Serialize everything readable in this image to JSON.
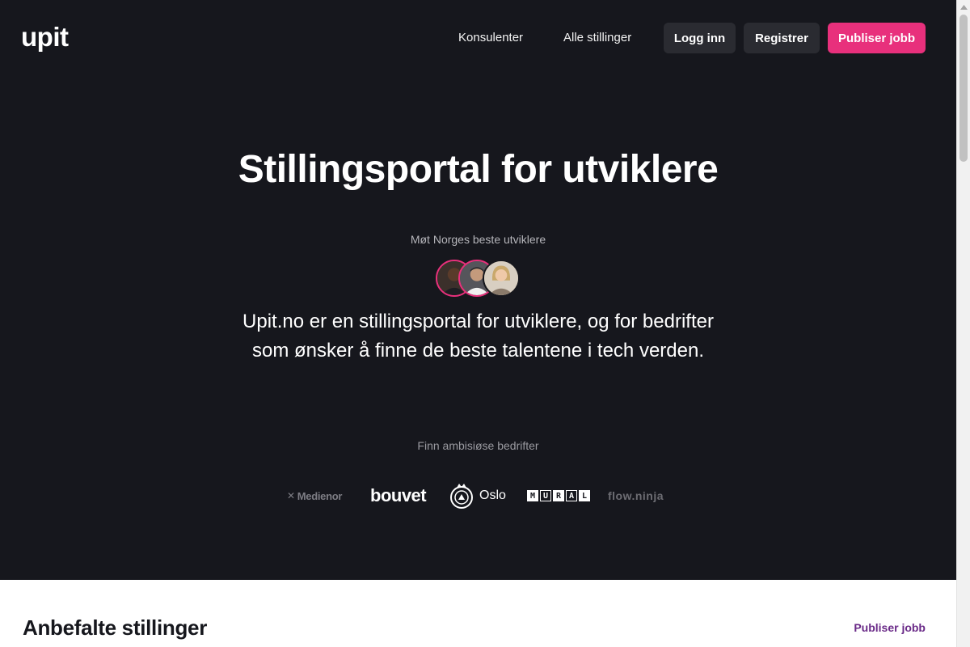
{
  "header": {
    "logo": "upit",
    "nav": [
      {
        "label": "Konsulenter"
      },
      {
        "label": "Alle stillinger"
      }
    ],
    "login_label": "Logg inn",
    "register_label": "Registrer",
    "publish_label": "Publiser jobb"
  },
  "hero": {
    "title": "Stillingsportal for utviklere",
    "subtitle": "Møt Norges beste utviklere",
    "description": "Upit.no er en stillingsportal for utviklere, og for bedrifter som ønsker å finne de beste talentene i tech verden.",
    "companies_label": "Finn ambisiøse bedrifter",
    "companies": [
      {
        "name": "Medienor",
        "icon": "medienor-x-icon"
      },
      {
        "name": "bouvet"
      },
      {
        "name": "Oslo",
        "icon": "oslo-seal-icon"
      },
      {
        "name": "MURAL"
      },
      {
        "name": "flow.ninja"
      }
    ]
  },
  "recommended": {
    "title": "Anbefalte stillinger",
    "publish_link": "Publiser jobb"
  },
  "colors": {
    "accent": "#e8307c",
    "hero_bg": "#16171d",
    "link_purple": "#6a2a88"
  }
}
